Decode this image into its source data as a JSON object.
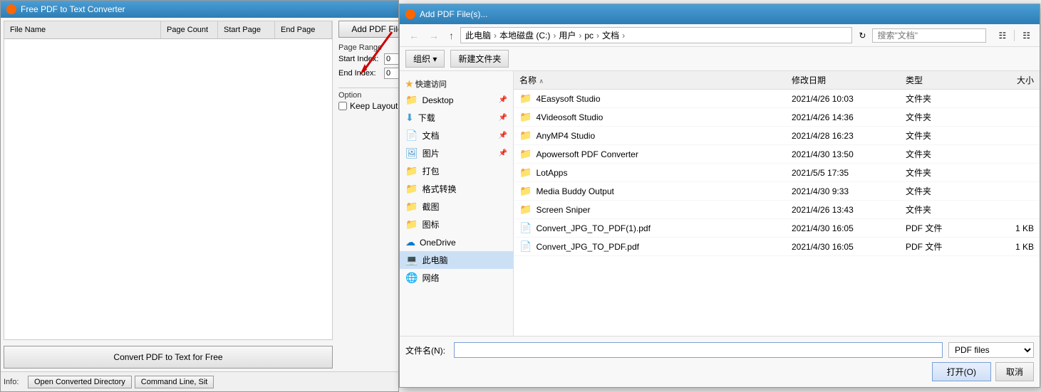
{
  "app": {
    "title": "Free PDF to Text Converter",
    "title_icon": "pdf-icon",
    "table": {
      "columns": [
        {
          "id": "filename",
          "label": "File Name"
        },
        {
          "id": "pagecount",
          "label": "Page Count"
        },
        {
          "id": "startpage",
          "label": "Start Page"
        },
        {
          "id": "endpage",
          "label": "End Page"
        }
      ],
      "rows": []
    },
    "toolbar": {
      "add_btn": "Add PDF File(s)"
    },
    "side_controls": {
      "page_range_label": "Page Range",
      "start_index_label": "Start Index:",
      "start_index_value": "0",
      "end_index_label": "End Index:",
      "end_index_value": "0",
      "option_label": "Option",
      "keep_layout_label": "Keep Layout",
      "keep_layout_checked": false
    },
    "convert_btn": "Convert PDF to Text for Free",
    "status_bar": {
      "info_label": "Info:",
      "open_dir_btn": "Open Converted Directory",
      "cmdline_btn": "Command Line, Sit"
    }
  },
  "dialog": {
    "title": "Add PDF File(s)...",
    "title_icon": "pdf-icon",
    "nav": {
      "back_disabled": true,
      "forward_disabled": true,
      "up_label": "↑",
      "address": [
        {
          "label": "此电脑"
        },
        {
          "label": "本地磁盘 (C:)"
        },
        {
          "label": "用户"
        },
        {
          "label": "pc"
        },
        {
          "label": "文档"
        }
      ],
      "search_placeholder": "搜索\"文档\""
    },
    "action_bar": {
      "organize_btn": "组织 ▾",
      "new_folder_btn": "新建文件夹"
    },
    "sidebar": {
      "quick_access_label": "★ 快速访问",
      "items": [
        {
          "label": "Desktop",
          "icon": "folder-yellow",
          "pin": true
        },
        {
          "label": "下载",
          "icon": "folder-download",
          "pin": true
        },
        {
          "label": "文档",
          "icon": "folder-doc",
          "pin": true
        },
        {
          "label": "图片",
          "icon": "folder-pic",
          "pin": true
        },
        {
          "label": "打包",
          "icon": "folder-yellow"
        },
        {
          "label": "格式转换",
          "icon": "folder-yellow"
        },
        {
          "label": "截图",
          "icon": "folder-yellow"
        },
        {
          "label": "图标",
          "icon": "folder-yellow"
        }
      ],
      "cloud_label": "OneDrive",
      "thispc_label": "此电脑",
      "network_label": "网络"
    },
    "file_list": {
      "columns": [
        {
          "id": "name",
          "label": "名称",
          "sort": "asc"
        },
        {
          "id": "date",
          "label": "修改日期"
        },
        {
          "id": "type",
          "label": "类型"
        },
        {
          "id": "size",
          "label": "大小"
        }
      ],
      "items": [
        {
          "name": "4Easysoft Studio",
          "date": "2021/4/26 10:03",
          "type": "文件夹",
          "size": "",
          "icon": "folder"
        },
        {
          "name": "4Videosoft Studio",
          "date": "2021/4/26 14:36",
          "type": "文件夹",
          "size": "",
          "icon": "folder"
        },
        {
          "name": "AnyMP4 Studio",
          "date": "2021/4/28 16:23",
          "type": "文件夹",
          "size": "",
          "icon": "folder"
        },
        {
          "name": "Apowersoft PDF Converter",
          "date": "2021/4/30 13:50",
          "type": "文件夹",
          "size": "",
          "icon": "folder"
        },
        {
          "name": "LotApps",
          "date": "2021/5/5 17:35",
          "type": "文件夹",
          "size": "",
          "icon": "folder"
        },
        {
          "name": "Media Buddy Output",
          "date": "2021/4/30 9:33",
          "type": "文件夹",
          "size": "",
          "icon": "folder"
        },
        {
          "name": "Screen Sniper",
          "date": "2021/4/26 13:43",
          "type": "文件夹",
          "size": "",
          "icon": "folder"
        },
        {
          "name": "Convert_JPG_TO_PDF(1).pdf",
          "date": "2021/4/30 16:05",
          "type": "PDF 文件",
          "size": "1 KB",
          "icon": "pdf"
        },
        {
          "name": "Convert_JPG_TO_PDF.pdf",
          "date": "2021/4/30 16:05",
          "type": "PDF 文件",
          "size": "1 KB",
          "icon": "pdf"
        }
      ]
    },
    "bottom": {
      "filename_label": "文件名(N):",
      "filename_value": "",
      "filetype_label": "PDF files",
      "open_btn": "打开(O)",
      "cancel_btn": "取消"
    }
  }
}
